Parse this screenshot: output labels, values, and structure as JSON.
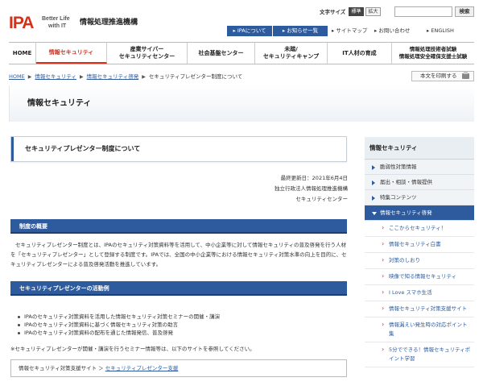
{
  "header": {
    "logo_ipa": "IPA",
    "logo_tag1": "Better Life",
    "logo_tag2": "with IT",
    "org_name": "情報処理推進機構",
    "font_size_label": "文字サイズ",
    "font_std": "標準",
    "font_large": "拡大",
    "search_placeholder": "",
    "search_button": "検索"
  },
  "utility": [
    {
      "label": "IPAについて"
    },
    {
      "label": "お知らせ一覧"
    },
    {
      "label": "サイトマップ"
    },
    {
      "label": "お問い合わせ"
    },
    {
      "label": "ENGLISH"
    }
  ],
  "gnav": [
    {
      "label": "HOME"
    },
    {
      "label": "情報セキュリティ"
    },
    {
      "label": "産業サイバー\nセキュリティセンター"
    },
    {
      "label": "社会基盤センター"
    },
    {
      "label": "未踏/\nセキュリティキャンプ"
    },
    {
      "label": "IT人材の育成"
    },
    {
      "label": "情報処理技術者試験\n情報処理安全確保支援士試験"
    }
  ],
  "breadcrumb": [
    "HOME",
    "情報セキュリティ",
    "情報セキュリティ啓発",
    "セキュリティプレゼンター制度について"
  ],
  "print_label": "本文を印刷する",
  "band_title": "情報セキュリティ",
  "page_title": "セキュリティプレゼンター制度について",
  "meta": {
    "updated": "最終更新日：2021年6月4日",
    "org": "独立行政法人情報処理推進機構",
    "center": "セキュリティセンター"
  },
  "section1": {
    "heading": "制度の概要",
    "body": "セキュリティプレゼンター制度とは、IPAのセキュリティ対策資料等を活用して、中小企業等に対して情報セキュリティの普及啓発を行う人材を「セキュリティプレゼンター」として登録する制度です。IPAでは、全国の中小企業等における情報セキュリティ対策水準の向上を目的に、セキュリティプレゼンターによる普及啓発活動を推進しています。"
  },
  "section2": {
    "heading": "セキュリティプレゼンターの活動例",
    "items": [
      "IPAのセキュリティ対策資料を活用した情報セキュリティ対策セミナーの開催・講演",
      "IPAのセキュリティ対策資料に基づく情報セキュリティ対策の助言",
      "IPAのセキュリティ対策資料の配布を通じた情報発信、普及啓発"
    ],
    "note": "※セキュリティプレゼンターが開催・講演を行うセミナー情報等は、以下のサイトを参照してください。",
    "linkbox_prefix": "情報セキュリティ対策支援サイト ＞ ",
    "linkbox_link": "セキュリティプレゼンター支援"
  },
  "sidebar": {
    "title": "情報セキュリティ",
    "items": [
      {
        "label": "脆弱性対策情報"
      },
      {
        "label": "届出・相談・情報提供"
      },
      {
        "label": "特集コンテンツ"
      },
      {
        "label": "情報セキュリティ啓発"
      }
    ],
    "subitems": [
      {
        "label": "ここからセキュリティ！"
      },
      {
        "label": "情報セキュリティ白書"
      },
      {
        "label": "対策のしおり"
      },
      {
        "label": "映像で知る情報セキュリティ"
      },
      {
        "label": "I Love スマホ生活"
      },
      {
        "label": "情報セキュリティ対策支援サイト"
      },
      {
        "label": "情報漏えい発生時の対応ポイント集"
      },
      {
        "label": "5分でできる！情報セキュリティポイント学習"
      }
    ]
  },
  "colors": {
    "brand_red": "#d6301b",
    "brand_blue": "#2d5b9e"
  }
}
